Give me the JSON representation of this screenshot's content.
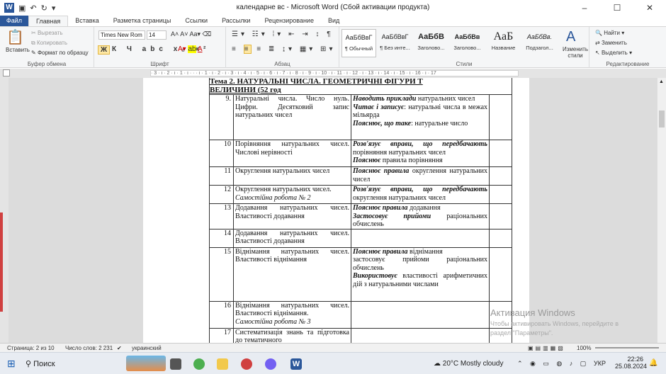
{
  "window": {
    "title": "календарне вс  -  Microsoft Word (Сбой активации продукта)"
  },
  "tabs": [
    "Файл",
    "Главная",
    "Вставка",
    "Разметка страницы",
    "Ссылки",
    "Рассылки",
    "Рецензирование",
    "Вид"
  ],
  "ribbon": {
    "clipboard": {
      "paste": "Вставить",
      "cut": "Вырезать",
      "copy": "Копировать",
      "format": "Формат по образцу",
      "label": "Буфер обмена"
    },
    "font": {
      "name": "Times New Rom",
      "size": "14",
      "label": "Шрифт"
    },
    "paragraph": {
      "label": "Абзац"
    },
    "styles": {
      "items": [
        {
          "preview": "АаБбВвГ",
          "name": "¶ Обычный"
        },
        {
          "preview": "АаБбВвГ",
          "name": "¶ Без инте..."
        },
        {
          "preview": "АаБбВ",
          "name": "Заголово..."
        },
        {
          "preview": "АаБбВв",
          "name": "Заголово..."
        },
        {
          "preview": "АаБ",
          "name": "Название"
        },
        {
          "preview": "АаБбВв.",
          "name": "Подзагол..."
        }
      ],
      "change": "Изменить стили",
      "label": "Стили"
    },
    "editing": {
      "find": "Найти",
      "replace": "Заменить",
      "select": "Выделить",
      "label": "Редактирование"
    }
  },
  "ruler": "· 3 · ı · 2 · ı · 1 · ı · · · ı · 1 · ı · 2 · ı · 3 · ı · 4 · ı · 5 · ı · 6 · ı · 7 · ı · 8 · ı · 9 · ı · 10 · ı · 11 · ı · 12 · ı · 13 · ı · 14 · ı · 15 · ı · 16 · ı · 17",
  "document": {
    "topic_line1": "Тема 2. НАТУРАЛЬНІ ЧИСЛА. ГЕОМЕТРИЧНІ ФІГУРИ Т",
    "topic_line2": "ВЕЛИЧИНИ (52 год",
    "rows": [
      {
        "n": "9.",
        "topic": "Натуральні числа. Число нуль. Цифри. Десятковий запис натуральних чисел",
        "skills": [
          {
            "b": "Наводить приклади",
            "t": " натуральних чисел"
          },
          {
            "b": "Читає і записує",
            "t": ": натуральні числа в межах мільярда"
          },
          {
            "b": "Пояснює, що таке",
            "t": ": натуральне число"
          }
        ]
      },
      {
        "n": "10",
        "topic": "Порівняння натуральних чисел. Числові нерівності",
        "skills": [
          {
            "b": "Розв'язує вправи, що передбачають",
            "t": " порівняння натуральних чисел"
          },
          {
            "b": "Пояснює",
            "t": " правила порівняння"
          }
        ]
      },
      {
        "n": "11",
        "topic": "Округлення натуральних чисел",
        "skills": [
          {
            "b": "Пояснює правила",
            "t": " округлення натуральних чисел"
          }
        ]
      },
      {
        "n": "12",
        "topic": "Округлення натуральних чисел.",
        "topic_it": "Самостійна робота № 2",
        "skills": [
          {
            "b": "Розв'язує вправи, що передбачають",
            "t": " округлення натуральних чисел"
          }
        ]
      },
      {
        "n": "13",
        "topic": "Додавання натуральних чисел. Властивості додавання",
        "skills": [
          {
            "b": "Пояснює правила",
            "t": " додавання"
          },
          {
            "b": "Застосовує прийоми",
            "t": " раціональних обчислень"
          }
        ]
      },
      {
        "n": "14",
        "topic": "Додавання натуральних чисел. Властивості додавання",
        "skills": []
      },
      {
        "n": "15",
        "topic": "Віднімання натуральних чисел. Властивості віднімання",
        "skills": [
          {
            "b": "Пояснює правила",
            "t": " віднімання"
          },
          {
            "b": "",
            "t": "застосовує прийоми раціональних обчислень"
          },
          {
            "b": "Використовує",
            "t": " властивості арифметичних дій з натуральними числами"
          }
        ]
      },
      {
        "n": "16",
        "topic": "Віднімання натуральних чисел. Властивості віднімання.",
        "topic_it": "Самостійна робота № 3",
        "skills": []
      },
      {
        "n": "17",
        "topic": "Систематизація знань та підготовка до тематичного",
        "skills": []
      }
    ]
  },
  "status": {
    "page": "Страница: 2 из 10",
    "words": "Число слов: 2 231",
    "lang": "украинский",
    "zoom": "100%"
  },
  "watermark": {
    "line1": "Активация Windows",
    "line2": "Чтобы активировать Windows, перейдите в",
    "line3": "раздел \"Параметры\"."
  },
  "taskbar": {
    "search": "Поиск",
    "weather": "20°C  Mostly cloudy",
    "lang": "УКР",
    "time": "22:26",
    "date": "25.08.2024"
  }
}
